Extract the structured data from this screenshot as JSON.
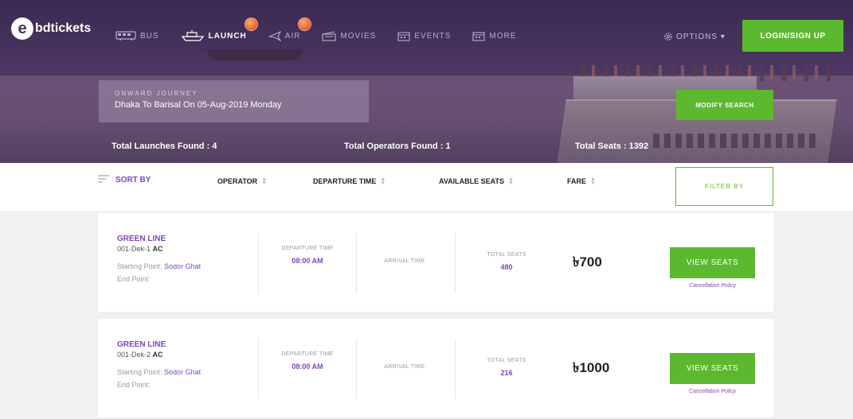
{
  "brand": {
    "logo_letter": "e",
    "name": "bdtickets",
    "accent": "#5cb82e",
    "purple": "#7d46b8"
  },
  "nav": {
    "items": [
      {
        "label": "BUS",
        "icon": "bus-icon",
        "active": false,
        "badge": false
      },
      {
        "label": "LAUNCH",
        "icon": "launch-icon",
        "active": true,
        "badge": true
      },
      {
        "label": "AIR",
        "icon": "plane-icon",
        "active": false,
        "badge": true
      },
      {
        "label": "MOVIES",
        "icon": "movie-icon",
        "active": false,
        "badge": false
      },
      {
        "label": "EVENTS",
        "icon": "events-icon",
        "active": false,
        "badge": false
      },
      {
        "label": "MORE",
        "icon": "more-icon",
        "active": false,
        "badge": false
      }
    ],
    "options_label": "OPTIONS ▾",
    "login_label": "LOGIN/SIGN UP"
  },
  "journey": {
    "label": "ONWARD JOURNEY",
    "route": "Dhaka To Barisal On 05-Aug-2019 Monday",
    "modify_label": "MODIFY SEARCH"
  },
  "summary": {
    "launches": "Total Launches Found : 4",
    "operators": "Total Operators Found : 1",
    "seats": "Total Seats : 1392"
  },
  "sort": {
    "label": "SORT BY",
    "columns": [
      "OPERATOR",
      "DEPARTURE TIME",
      "AVAILABLE SEATS",
      "FARE"
    ],
    "filter_label": "FILTER BY"
  },
  "results": [
    {
      "operator": "GREEN LINE",
      "code": "001-Dek-1",
      "class": "AC",
      "start_label": "Starting Point:",
      "start_point": "Sodor Ghat",
      "end_label": "End Point:",
      "departure_label": "DEPARTURE TIME",
      "departure_time": "08:00 AM",
      "arrival_label": "ARRIVAL TIME",
      "seats_label": "TOTAL SEATS",
      "seats": "480",
      "fare": "৳700",
      "button_label": "VIEW SEATS",
      "cancel_label": "Cancellation Policy"
    },
    {
      "operator": "GREEN LINE",
      "code": "001-Dek-2",
      "class": "AC",
      "start_label": "Starting Point:",
      "start_point": "Sodor Ghat",
      "end_label": "End Point:",
      "departure_label": "DEPARTURE TIME",
      "departure_time": "08:00 AM",
      "arrival_label": "ARRIVAL TIME",
      "seats_label": "TOTAL SEATS",
      "seats": "216",
      "fare": "৳1000",
      "button_label": "VIEW SEATS",
      "cancel_label": "Cancellation Policy"
    }
  ]
}
